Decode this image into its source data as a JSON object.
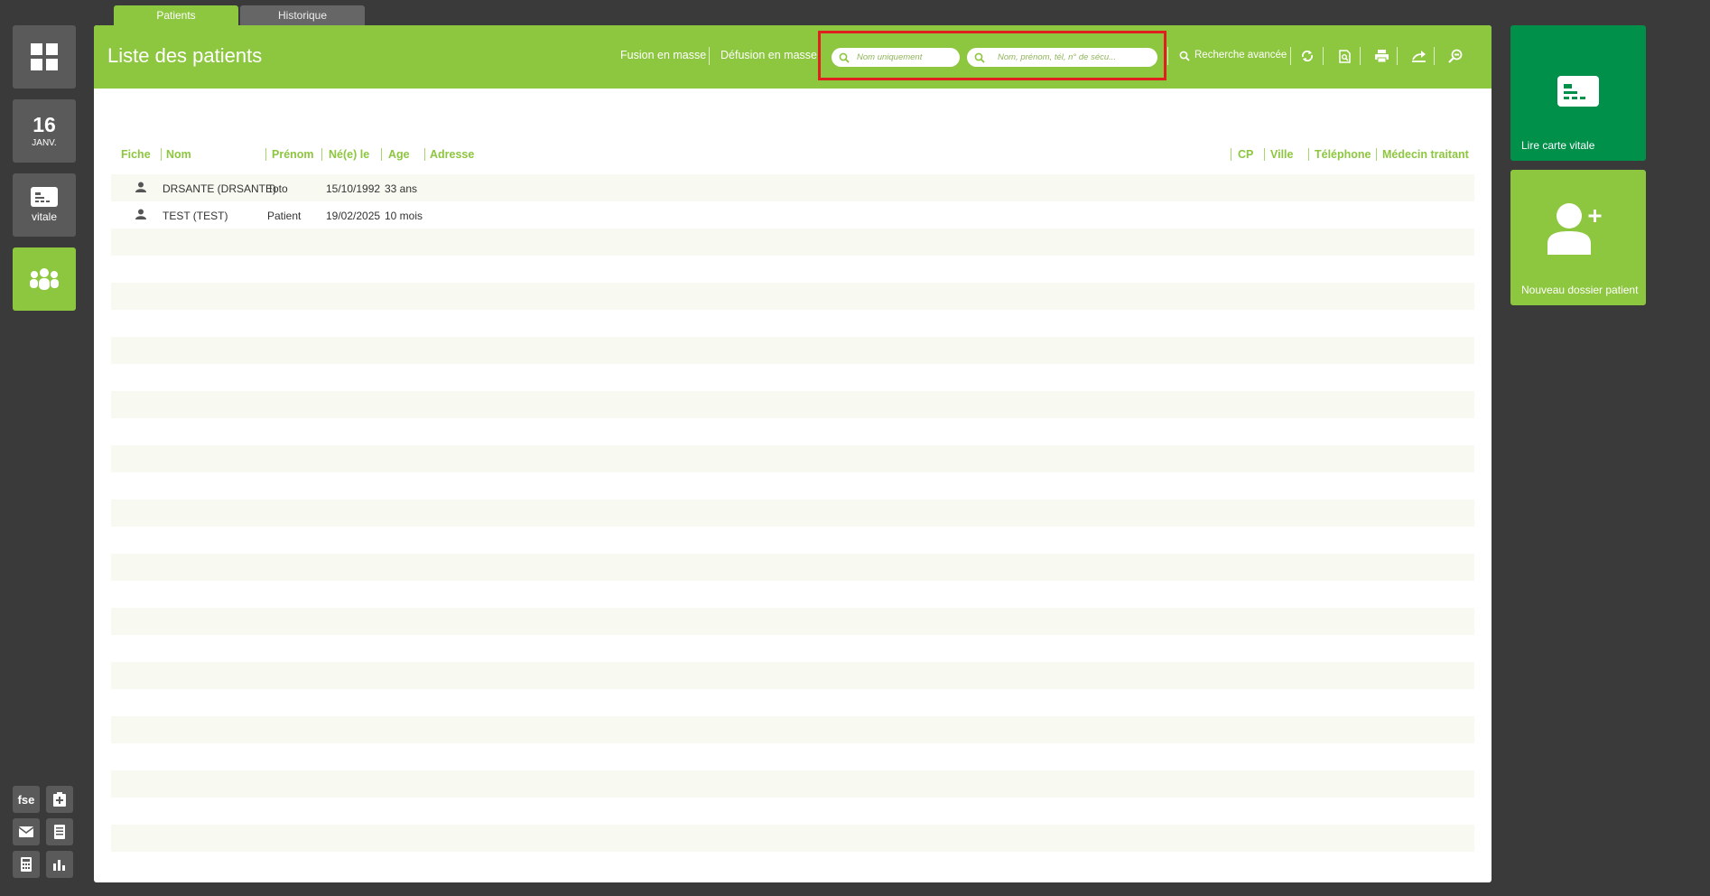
{
  "tabs": [
    {
      "label": "Patients",
      "active": true
    },
    {
      "label": "Historique",
      "active": false
    }
  ],
  "left_rail": {
    "dashboard_icon": "grid-icon",
    "date": {
      "day": "16",
      "month": "JANV."
    },
    "vitale_label": "vitale",
    "patients_icon": "group-icon",
    "bottom_tools": [
      {
        "name": "fse",
        "label": "fse"
      },
      {
        "name": "medical-kit",
        "icon": "medical-kit-icon"
      },
      {
        "name": "mail",
        "icon": "mail-icon"
      },
      {
        "name": "document",
        "icon": "document-icon"
      },
      {
        "name": "calculator",
        "icon": "calculator-icon"
      },
      {
        "name": "stats",
        "icon": "bar-chart-icon"
      }
    ]
  },
  "header": {
    "title": "Liste des patients",
    "fusion_label": "Fusion en masse",
    "defusion_label": "Défusion en masse",
    "search_name_placeholder": "Nom uniquement",
    "search_full_placeholder": "Nom, prénom, tél, n° de sécu...",
    "advanced_search_label": "Recherche avancée",
    "tool_icons": [
      "refresh-icon",
      "preview-icon",
      "print-icon",
      "export-icon",
      "zoom-search-icon"
    ]
  },
  "table": {
    "columns": {
      "fiche": "Fiche",
      "nom": "Nom",
      "prenom": "Prénom",
      "nee_le": "Né(e) le",
      "age": "Age",
      "adresse": "Adresse",
      "cp": "CP",
      "ville": "Ville",
      "telephone": "Téléphone",
      "medecin": "Médecin traitant"
    },
    "rows": [
      {
        "nom": "DRSANTE (DRSANTE)",
        "prenom": "Toto",
        "nee_le": "15/10/1992",
        "age": "33 ans"
      },
      {
        "nom": "TEST (TEST)",
        "prenom": "Patient",
        "nee_le": "19/02/2025",
        "age": "10 mois"
      }
    ]
  },
  "right_tiles": {
    "lire_carte": "Lire carte vitale",
    "nouveau_dossier": "Nouveau dossier patient"
  },
  "colors": {
    "accent": "#8dc63f",
    "dark_green": "#00904a",
    "background": "#3a3a3a",
    "highlight": "#e0201e"
  }
}
